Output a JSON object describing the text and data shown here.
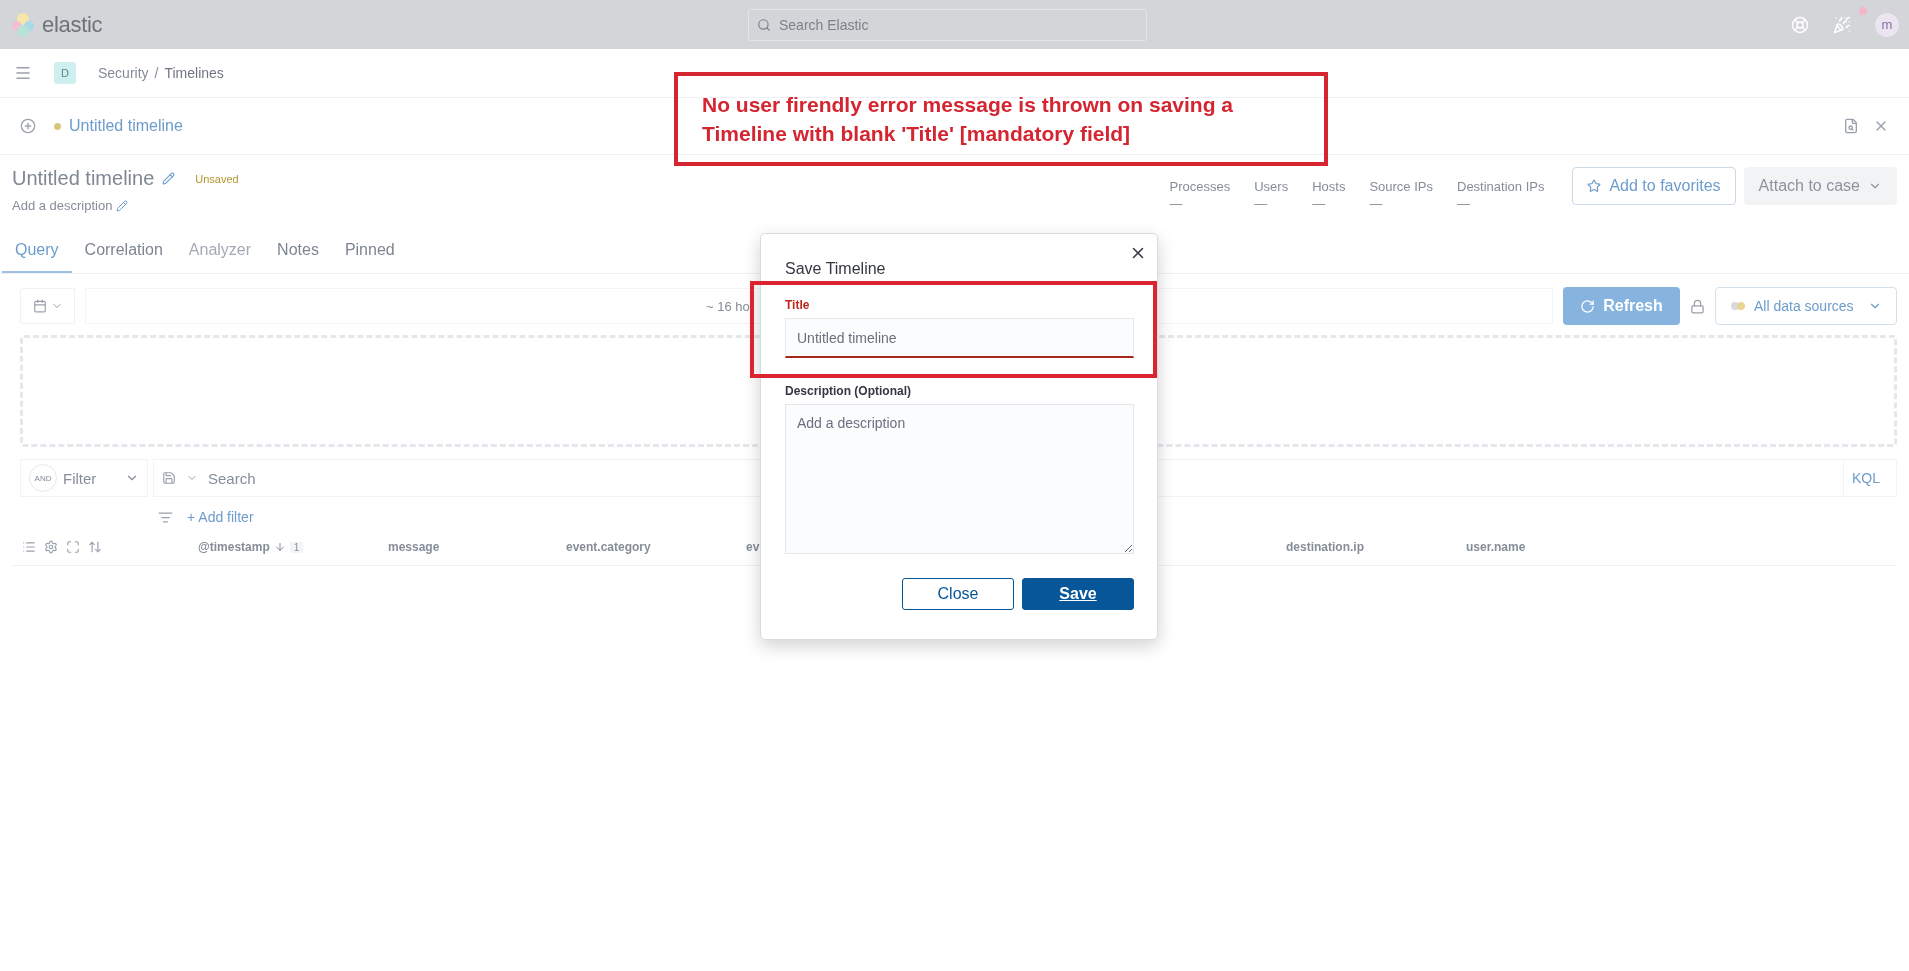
{
  "header": {
    "logo": "elastic",
    "search": {
      "placeholder": "Search Elastic"
    },
    "avatar": "m"
  },
  "breadcrumbs": {
    "space": "D",
    "separator": "/",
    "items": [
      "Security",
      "Timelines"
    ]
  },
  "timeline_tab": {
    "label": "Untitled timeline"
  },
  "timeline": {
    "title": "Untitled timeline",
    "status": "Unsaved",
    "description_placeholder": "Add a description"
  },
  "stats": [
    {
      "label": "Processes",
      "value": "—"
    },
    {
      "label": "Users",
      "value": "—"
    },
    {
      "label": "Hosts",
      "value": "—"
    },
    {
      "label": "Source IPs",
      "value": "—"
    },
    {
      "label": "Destination IPs",
      "value": "—"
    }
  ],
  "actions": [
    {
      "label": "Add to favorites",
      "kind": "favorite",
      "disabled": false
    },
    {
      "label": "Attach to case",
      "kind": "dropdown",
      "disabled": true
    }
  ],
  "tabs": [
    {
      "label": "Query",
      "selected": true,
      "disabled": false
    },
    {
      "label": "Correlation",
      "selected": false,
      "disabled": false
    },
    {
      "label": "Analyzer",
      "selected": false,
      "disabled": true
    },
    {
      "label": "Notes",
      "selected": false,
      "disabled": false
    },
    {
      "label": "Pinned",
      "selected": false,
      "disabled": false
    }
  ],
  "query_bar": {
    "time_range": "~ 16 ho",
    "refresh": "Refresh",
    "data_sources": "All data sources"
  },
  "filter_bar": {
    "operator": "AND",
    "filter": "Filter",
    "search_placeholder": "Search",
    "language": "KQL",
    "add_filter": "+ Add filter"
  },
  "columns": [
    {
      "label": "@timestamp",
      "sort_order": "1"
    },
    {
      "label": "message"
    },
    {
      "label": "event.category"
    },
    {
      "label": "ev"
    },
    {
      "label": "destination.ip"
    },
    {
      "label": "user.name"
    }
  ],
  "dialog": {
    "title": "Save Timeline",
    "fields": [
      {
        "kind": "input",
        "label": "Title",
        "placeholder": "Untitled timeline",
        "invalid": true
      },
      {
        "kind": "textarea",
        "label": "Description (Optional)",
        "placeholder": "Add a description",
        "invalid": false
      }
    ],
    "buttons": [
      {
        "kind": "secondary",
        "label": "Close"
      },
      {
        "kind": "primary",
        "label": "Save"
      }
    ]
  },
  "annotation": {
    "text": "No user firendly error message is thrown on saving a Timeline with blank 'Title' [mandatory field]"
  }
}
